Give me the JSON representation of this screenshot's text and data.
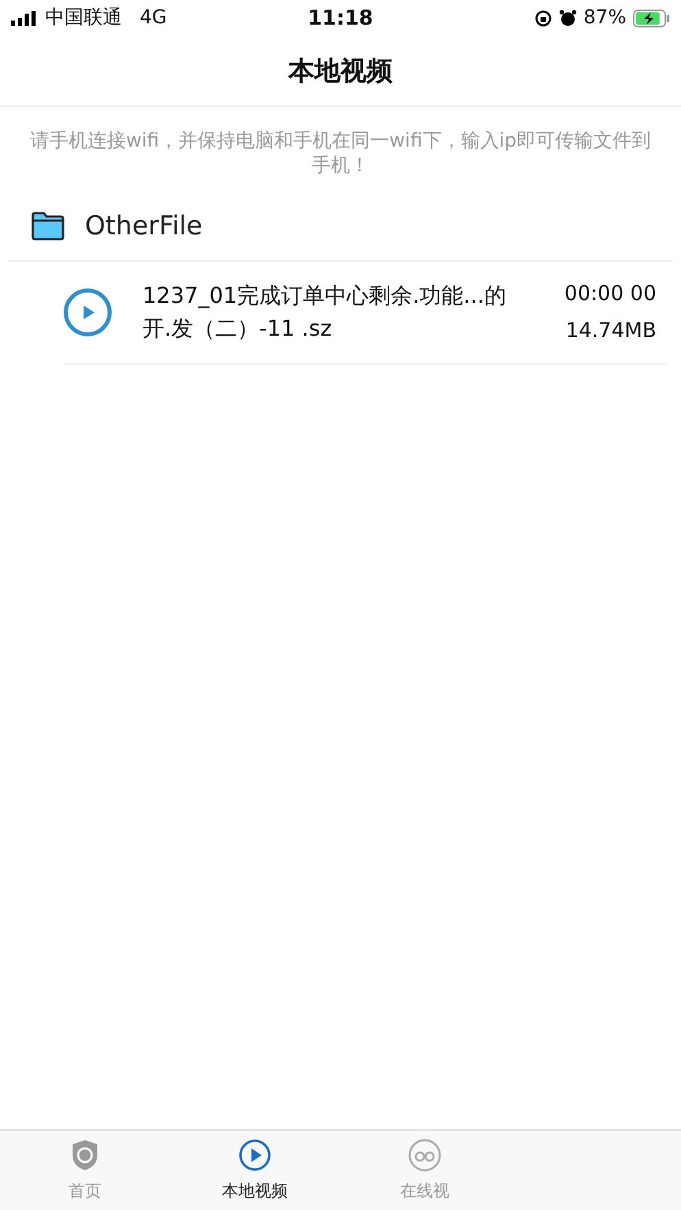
{
  "status_bar": {
    "carrier": "中国联通",
    "network": "4G",
    "time": "11:18",
    "battery": "87%",
    "level": 0.87,
    "charging": true
  },
  "nav": {
    "title": "本地视频"
  },
  "hint": "请手机连接wifi，并保持电脑和手机在同一wifi下，输入ip即可传输文件到手机！",
  "folders": [
    {
      "name": "OtherFile",
      "files": [
        {
          "name": "1237_01完成订单中心剩余.功能...的开.发（二）-11 .sz",
          "duration": "00:00 00",
          "size": "14.74MB"
        }
      ]
    }
  ],
  "tabs": [
    {
      "label": "首页",
      "kind": "home",
      "selected": false
    },
    {
      "label": "本地视频",
      "kind": "local",
      "selected": true
    },
    {
      "label": "在线视",
      "kind": "online",
      "selected": false
    }
  ]
}
